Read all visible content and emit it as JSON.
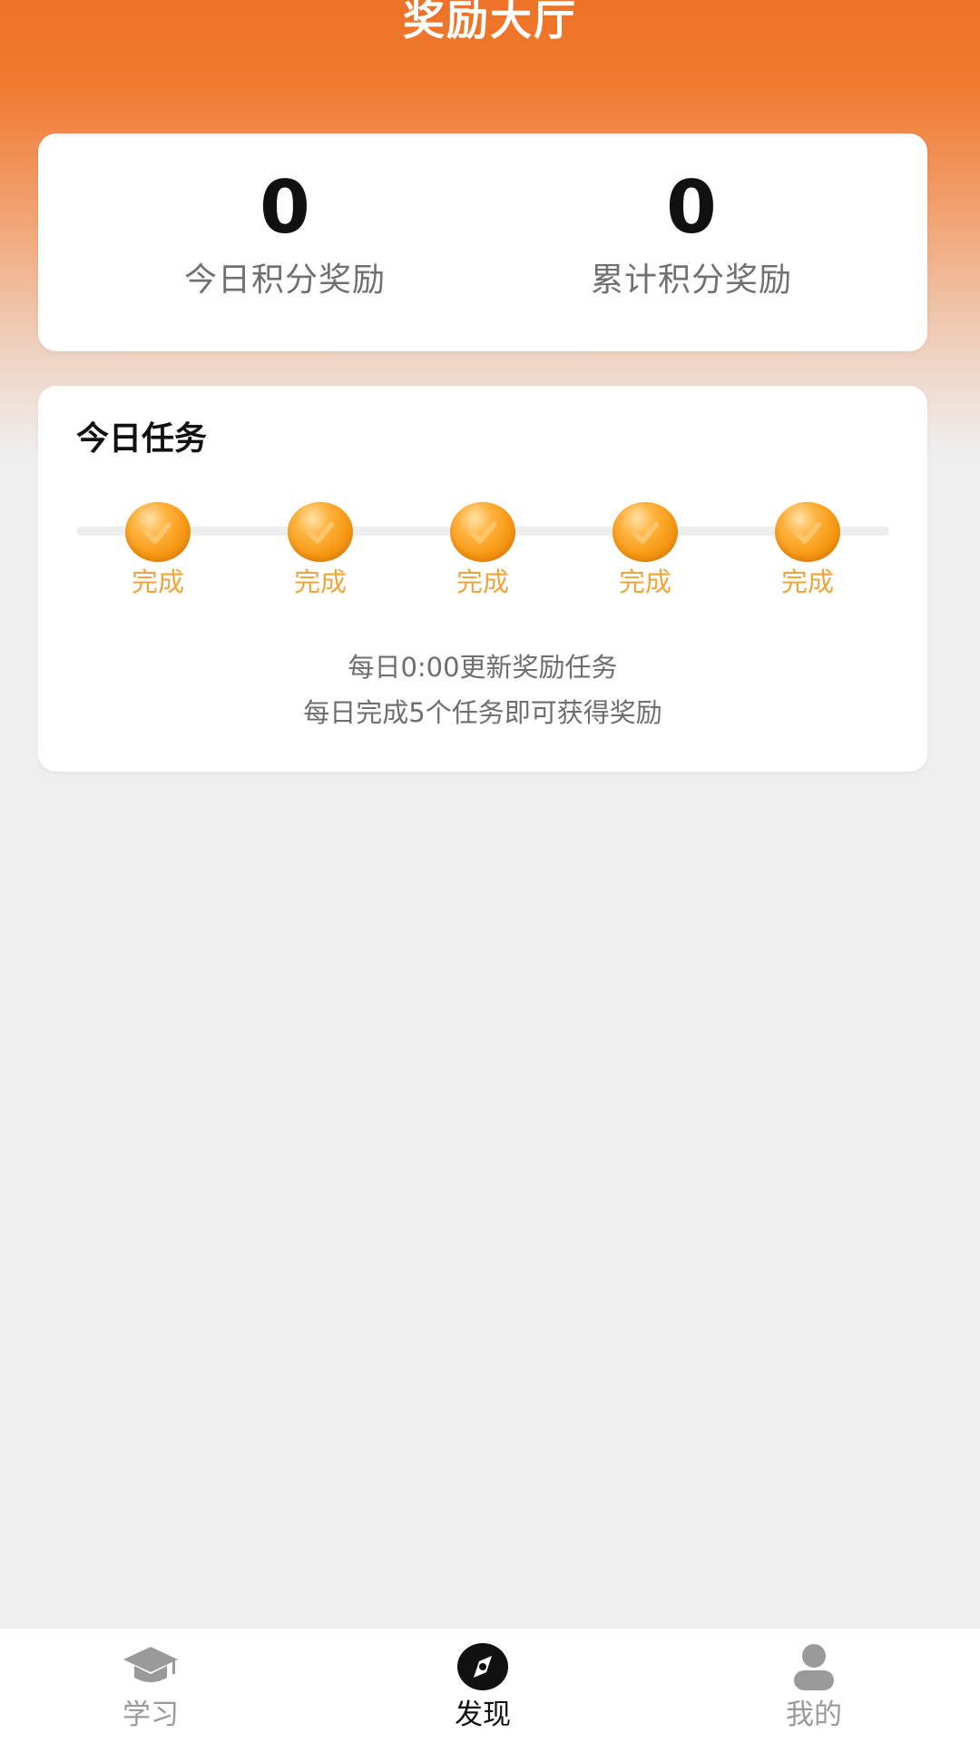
{
  "header": {
    "title": "奖励大厅",
    "accent_color": "#ee7228"
  },
  "points": {
    "today": {
      "value": "0",
      "label": "今日积分奖励"
    },
    "total": {
      "value": "0",
      "label": "累计积分奖励"
    }
  },
  "tasks": {
    "title": "今日任务",
    "items": [
      {
        "status": "完成",
        "icon": "gold-coin-check-icon"
      },
      {
        "status": "完成",
        "icon": "gold-coin-check-icon"
      },
      {
        "status": "完成",
        "icon": "gold-coin-check-icon"
      },
      {
        "status": "完成",
        "icon": "gold-coin-check-icon"
      },
      {
        "status": "完成",
        "icon": "gold-coin-check-icon"
      }
    ],
    "notes": [
      "每日0:00更新奖励任务",
      "每日完成5个任务即可获得奖励"
    ],
    "status_color": "#f0a43a"
  },
  "nav": {
    "items": [
      {
        "label": "学习",
        "icon": "graduation-cap-icon",
        "active": false
      },
      {
        "label": "发现",
        "icon": "compass-icon",
        "active": true
      },
      {
        "label": "我的",
        "icon": "user-icon",
        "active": false
      }
    ]
  }
}
